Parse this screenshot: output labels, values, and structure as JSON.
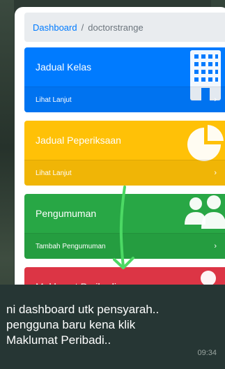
{
  "breadcrumb": {
    "home": "Dashboard",
    "separator": "/",
    "current": "doctorstrange"
  },
  "cards": [
    {
      "title": "Jadual Kelas",
      "footer": "Lihat Lanjut",
      "color": "#007bff",
      "icon": "building-icon"
    },
    {
      "title": "Jadual Peperiksaan",
      "footer": "Lihat Lanjut",
      "color": "#ffc107",
      "icon": "pie-chart-icon"
    },
    {
      "title": "Pengumuman",
      "footer": "Tambah Pengumuman",
      "color": "#28a745",
      "icon": "users-icon"
    },
    {
      "title": "Maklumat Peribadi",
      "footer": "",
      "color": "#dc3545",
      "icon": "user-icon"
    }
  ],
  "chevron": "›",
  "message": {
    "line1": "ni dashboard utk pensyarah..",
    "line2": "pengguna baru kena klik",
    "line3": "Maklumat Peribadi..",
    "time": "09:34"
  }
}
